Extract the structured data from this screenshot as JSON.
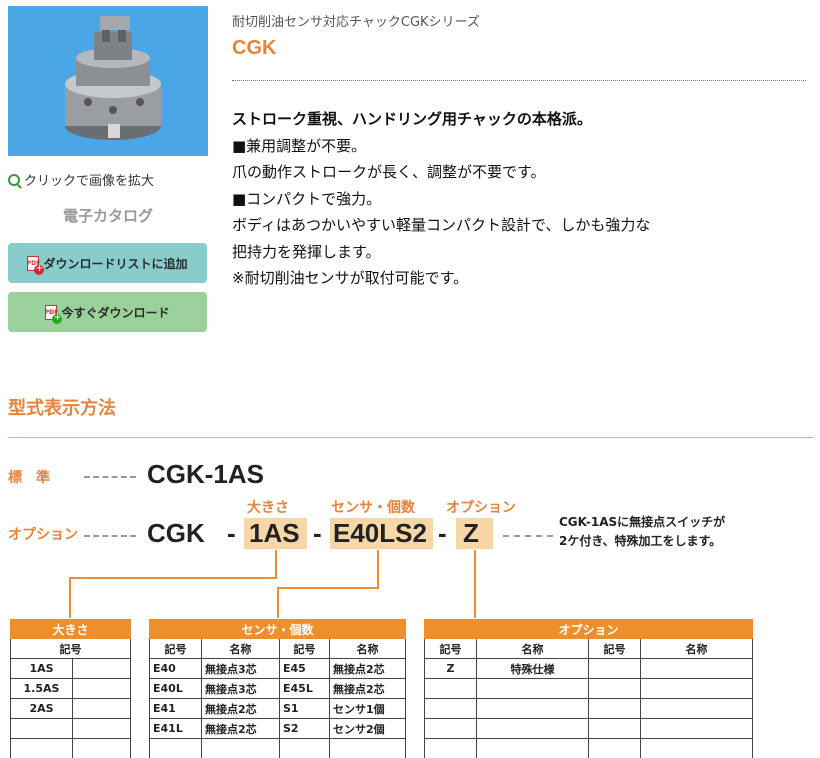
{
  "sidebar": {
    "zoom_link": "クリックで画像を拡大",
    "catalog_label": "電子カタログ",
    "add_to_list_button": "ダウンロードリストに追加",
    "download_now_button": "今すぐダウンロード",
    "pdf_icon_text": "PDF"
  },
  "product": {
    "series": "耐切削油センサ対応チャックCGKシリーズ",
    "title": "CGK",
    "lead": "ストローク重視、ハンドリング用チャックの本格派。",
    "lines": [
      "■兼用調整が不要。",
      "爪の動作ストロークが長く、調整が不要です。",
      "■コンパクトで強力。",
      "ボディはあつかいやすい軽量コンパクト設計で、しかも強力な",
      "把持力を発揮します。",
      "※耐切削油センサが取付可能です。"
    ]
  },
  "model_section": {
    "title": "型式表示方法",
    "standard_label": "標　準",
    "standard_model": "CGK-1AS",
    "option_label": "オプション",
    "parts": {
      "base": "CGK",
      "dash1": "-",
      "size": "1AS",
      "dash2": "-",
      "sensor": "E40LS2",
      "dash3": "-",
      "option": "Z"
    },
    "part_labels": {
      "size": "大きさ",
      "sensor": "センサ・個数",
      "option": "オプション"
    },
    "note_lines": [
      "CGK-1ASに無接点スイッチが",
      "2ケ付き、特殊加工をします。"
    ]
  },
  "tables": {
    "size": {
      "caption": "大きさ",
      "header": "記号",
      "rows": [
        "1AS",
        "1.5AS",
        "2AS",
        "",
        ""
      ]
    },
    "sensor": {
      "caption": "センサ・個数",
      "headers": [
        "記号",
        "名称",
        "記号",
        "名称"
      ],
      "rows": [
        [
          "E40",
          "無接点3芯",
          "E45",
          "無接点2芯"
        ],
        [
          "E40L",
          "無接点3芯",
          "E45L",
          "無接点2芯"
        ],
        [
          "E41",
          "無接点2芯",
          "S1",
          "センサ1個"
        ],
        [
          "E41L",
          "無接点2芯",
          "S2",
          "センサ2個"
        ],
        [
          "",
          "",
          "",
          ""
        ]
      ]
    },
    "option": {
      "caption": "オプション",
      "headers": [
        "記号",
        "名称",
        "記号",
        "名称"
      ],
      "rows": [
        [
          "Z",
          "特殊仕様",
          "",
          ""
        ],
        [
          "",
          "",
          "",
          ""
        ],
        [
          "",
          "",
          "",
          ""
        ],
        [
          "",
          "",
          "",
          ""
        ],
        [
          "",
          "",
          "",
          ""
        ]
      ]
    }
  },
  "colors": {
    "accent_orange": "#e8833a",
    "table_header_orange": "#ee8f2c",
    "highlight_peach": "#f7d6a8",
    "image_bg_blue": "#4aa6e6",
    "btn_teal": "#88cccc",
    "btn_green": "#9ad09a"
  }
}
